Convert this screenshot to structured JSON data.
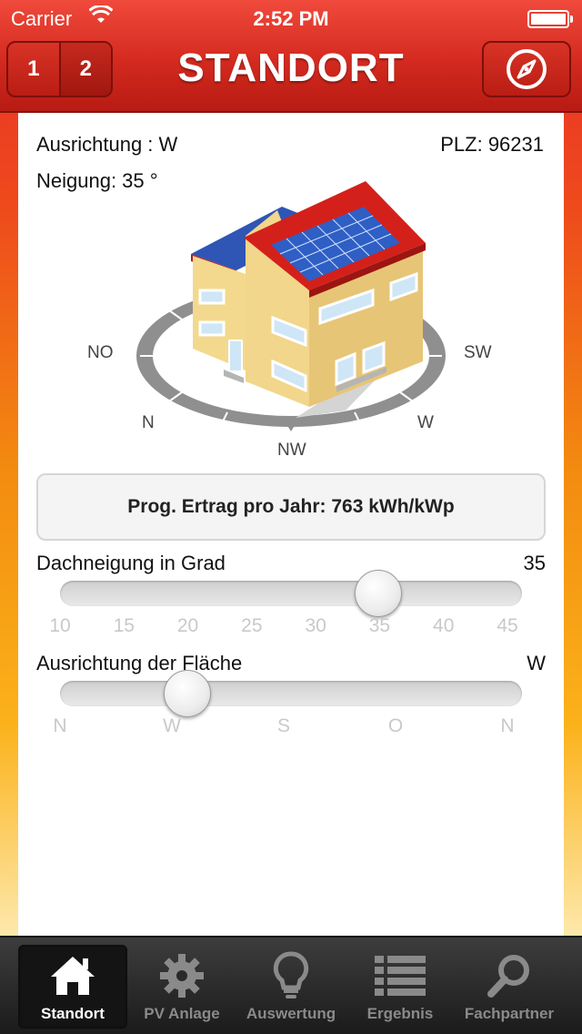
{
  "status_bar": {
    "carrier": "Carrier",
    "time": "2:52 PM"
  },
  "header": {
    "title": "STANDORT",
    "segments": [
      "1",
      "2"
    ],
    "compass_icon": "compass-icon"
  },
  "location": {
    "orientation_label": "Ausrichtung : W",
    "postcode_label": "PLZ: 96231",
    "tilt_label": "Neigung: 35 °"
  },
  "compass_directions": {
    "no": "NO",
    "sw": "SW",
    "n": "N",
    "w": "W",
    "nw": "NW"
  },
  "yield": {
    "text": "Prog. Ertrag pro Jahr: 763 kWh/kWp"
  },
  "tilt_slider": {
    "label": "Dachneigung in Grad",
    "value": "35",
    "ticks": [
      "10",
      "15",
      "20",
      "25",
      "30",
      "35",
      "40",
      "45"
    ],
    "fraction": 0.71
  },
  "orientation_slider": {
    "label": "Ausrichtung der Fläche",
    "value": "W",
    "ticks": [
      "N",
      "W",
      "S",
      "O",
      "N"
    ],
    "fraction": 0.25
  },
  "tabs": [
    {
      "label": "Standort",
      "icon": "home-icon",
      "active": true
    },
    {
      "label": "PV Anlage",
      "icon": "gear-icon",
      "active": false
    },
    {
      "label": "Auswertung",
      "icon": "lightbulb-icon",
      "active": false
    },
    {
      "label": "Ergebnis",
      "icon": "list-icon",
      "active": false
    },
    {
      "label": "Fachpartner",
      "icon": "search-icon",
      "active": false
    }
  ],
  "colors": {
    "brand_red": "#d42a1f",
    "tab_bg": "#1b1b1b"
  }
}
